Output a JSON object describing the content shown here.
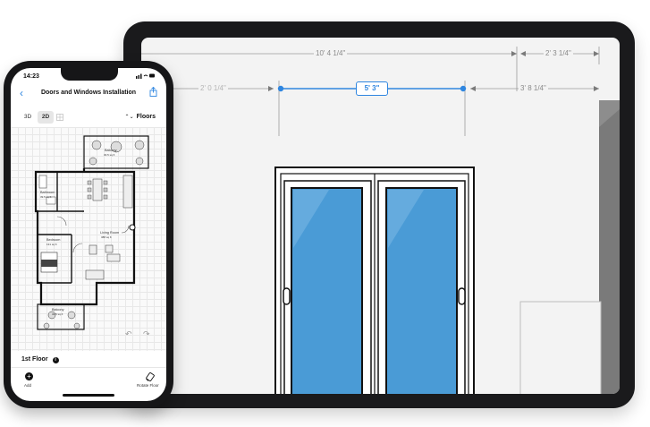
{
  "phone": {
    "status_time": "14:23",
    "status_icons": "signal wifi battery",
    "nav_title": "Doors and Windows Installation",
    "view_modes": [
      "3D",
      "2D"
    ],
    "active_view": "2D",
    "floors_label": "Floors",
    "plan_labels": {
      "balcony_top": "Balcony",
      "balcony_top_area": "30.5 sq ft",
      "bathroom": "Bathroom",
      "bathroom_area": "39.5 sq ft",
      "bedroom": "Bedroom",
      "bedroom_area": "131 sq ft",
      "living_room": "Living Room",
      "living_room_area": "388 sq ft",
      "balcony_bottom": "Balcony",
      "balcony_bottom_area": "30.5 sq ft"
    },
    "floor_name": "1st Floor",
    "add_label": "Add",
    "rotate_label": "Rotate Floor",
    "icons": {
      "back": "chevron-left-icon",
      "share": "share-icon",
      "undo": "undo-icon",
      "redo": "redo-icon",
      "info": "info-icon",
      "add": "plus-icon",
      "rotate": "rotate-icon"
    }
  },
  "tablet": {
    "dimensions": {
      "top_total": "10' 4 1/4\"",
      "top_right": "2' 3 1/4\"",
      "left_offset": "2' 0 1/4\"",
      "selected_width": "5' 3\"",
      "right_offset": "3' 8 1/4\""
    },
    "colors": {
      "accent": "#2f86e0",
      "glass": "#4a9bd6",
      "wall": "#f3f3f3"
    }
  }
}
